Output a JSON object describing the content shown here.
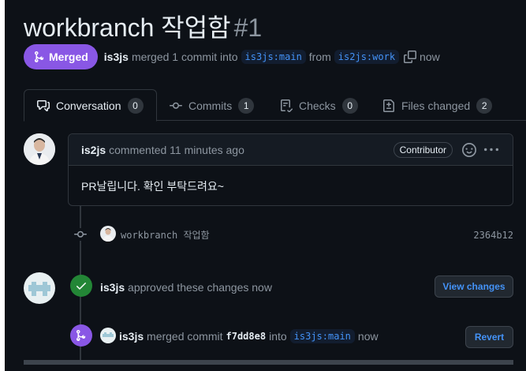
{
  "pr": {
    "title": "workbranch 작업함",
    "number": "#1",
    "state": "Merged",
    "author": "is3js",
    "merge_text": "merged 1 commit into",
    "base_branch": "is3js:main",
    "from_text": "from",
    "head_branch": "is2js:work",
    "when": "now"
  },
  "tabs": [
    {
      "label": "Conversation",
      "count": "0",
      "icon": "comment-discussion-icon"
    },
    {
      "label": "Commits",
      "count": "1",
      "icon": "git-commit-icon"
    },
    {
      "label": "Checks",
      "count": "0",
      "icon": "checklist-icon"
    },
    {
      "label": "Files changed",
      "count": "2",
      "icon": "file-diff-icon"
    }
  ],
  "comment": {
    "author": "is2js",
    "action": "commented 11 minutes ago",
    "role": "Contributor",
    "body": "PR날립니다. 확인 부탁드려요~"
  },
  "commit_event": {
    "message": "workbranch 작업함",
    "sha": "2364b12"
  },
  "approve_event": {
    "author": "is3js",
    "text": "approved these changes now",
    "button": "View changes"
  },
  "merge_event": {
    "author": "is3js",
    "text1": "merged commit",
    "sha": "f7dd8e8",
    "text2": "into",
    "branch": "is3js:main",
    "when": "now",
    "button": "Revert"
  },
  "colors": {
    "merged": "#8957e5",
    "approved": "#238636",
    "link": "#4493f8",
    "background": "#0d1117"
  }
}
